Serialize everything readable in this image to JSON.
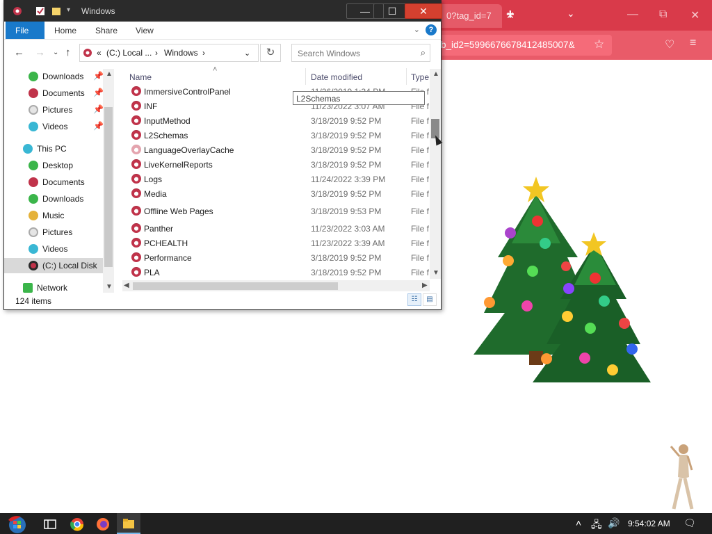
{
  "browser": {
    "tab_title": "0?tag_id=7",
    "tab_close": "✕",
    "new_tab": "+",
    "tab_list": "⌄",
    "url_text": "b_id2=5996676678412485007&",
    "min": "—",
    "restore": "⧉",
    "close": "✕"
  },
  "explorer": {
    "title": "Windows",
    "win_min": "—",
    "win_max": "☐",
    "win_close": "✕",
    "ribbon_tabs": [
      "File",
      "Home",
      "Share",
      "View"
    ],
    "help": "?",
    "address": {
      "root_prefix": "«",
      "crumb1": "(C:) Local ...",
      "sep": "›",
      "crumb2": "Windows"
    },
    "search_placeholder": "Search Windows",
    "nav": [
      {
        "label": "Downloads",
        "pinned": true
      },
      {
        "label": "Documents",
        "pinned": true
      },
      {
        "label": "Pictures",
        "pinned": true
      },
      {
        "label": "Videos",
        "pinned": true
      },
      {
        "label": "This PC",
        "pinned": false
      },
      {
        "label": "Desktop",
        "pinned": false
      },
      {
        "label": "Documents",
        "pinned": false
      },
      {
        "label": "Downloads",
        "pinned": false
      },
      {
        "label": "Music",
        "pinned": false
      },
      {
        "label": "Pictures",
        "pinned": false
      },
      {
        "label": "Videos",
        "pinned": false
      },
      {
        "label": "(C:) Local Disk",
        "pinned": false
      },
      {
        "label": "Network",
        "pinned": false
      }
    ],
    "columns": {
      "name": "Name",
      "date": "Date modified",
      "type": "Type"
    },
    "files": [
      {
        "name": "ImmersiveControlPanel",
        "date": "11/26/2019 1:34 PM",
        "type": "File f"
      },
      {
        "name": "INF",
        "date": "11/23/2022 3:07 AM",
        "type": "File f"
      },
      {
        "name": "InputMethod",
        "date": "3/18/2019 9:52 PM",
        "type": "File f"
      },
      {
        "name": "L2Schemas",
        "date": "3/18/2019 9:52 PM",
        "type": "File f"
      },
      {
        "name": "LanguageOverlayCache",
        "date": "3/18/2019 9:52 PM",
        "type": "File f"
      },
      {
        "name": "LiveKernelReports",
        "date": "3/18/2019 9:52 PM",
        "type": "File f"
      },
      {
        "name": "Logs",
        "date": "11/24/2022 3:39 PM",
        "type": "File f"
      },
      {
        "name": "Media",
        "date": "3/18/2019 9:52 PM",
        "type": "File f"
      },
      {
        "name": "Offline Web Pages",
        "date": "3/18/2019 9:53 PM",
        "type": "File f"
      },
      {
        "name": "Panther",
        "date": "11/23/2022 3:03 AM",
        "type": "File f"
      },
      {
        "name": "PCHEALTH",
        "date": "11/23/2022 3:39 AM",
        "type": "File f"
      },
      {
        "name": "Performance",
        "date": "3/18/2019 9:52 PM",
        "type": "File f"
      },
      {
        "name": "PLA",
        "date": "3/18/2019 9:52 PM",
        "type": "File f"
      }
    ],
    "tooltip": "L2Schemas",
    "status": "124 items"
  },
  "taskbar": {
    "clock": "9:54:02 AM"
  },
  "colors": {
    "browser_accent": "#d93a4a",
    "explorer_titlebar": "#2b2b2b",
    "file_tab": "#1979ca",
    "close_button": "#d4402f",
    "taskbar": "#202020"
  }
}
